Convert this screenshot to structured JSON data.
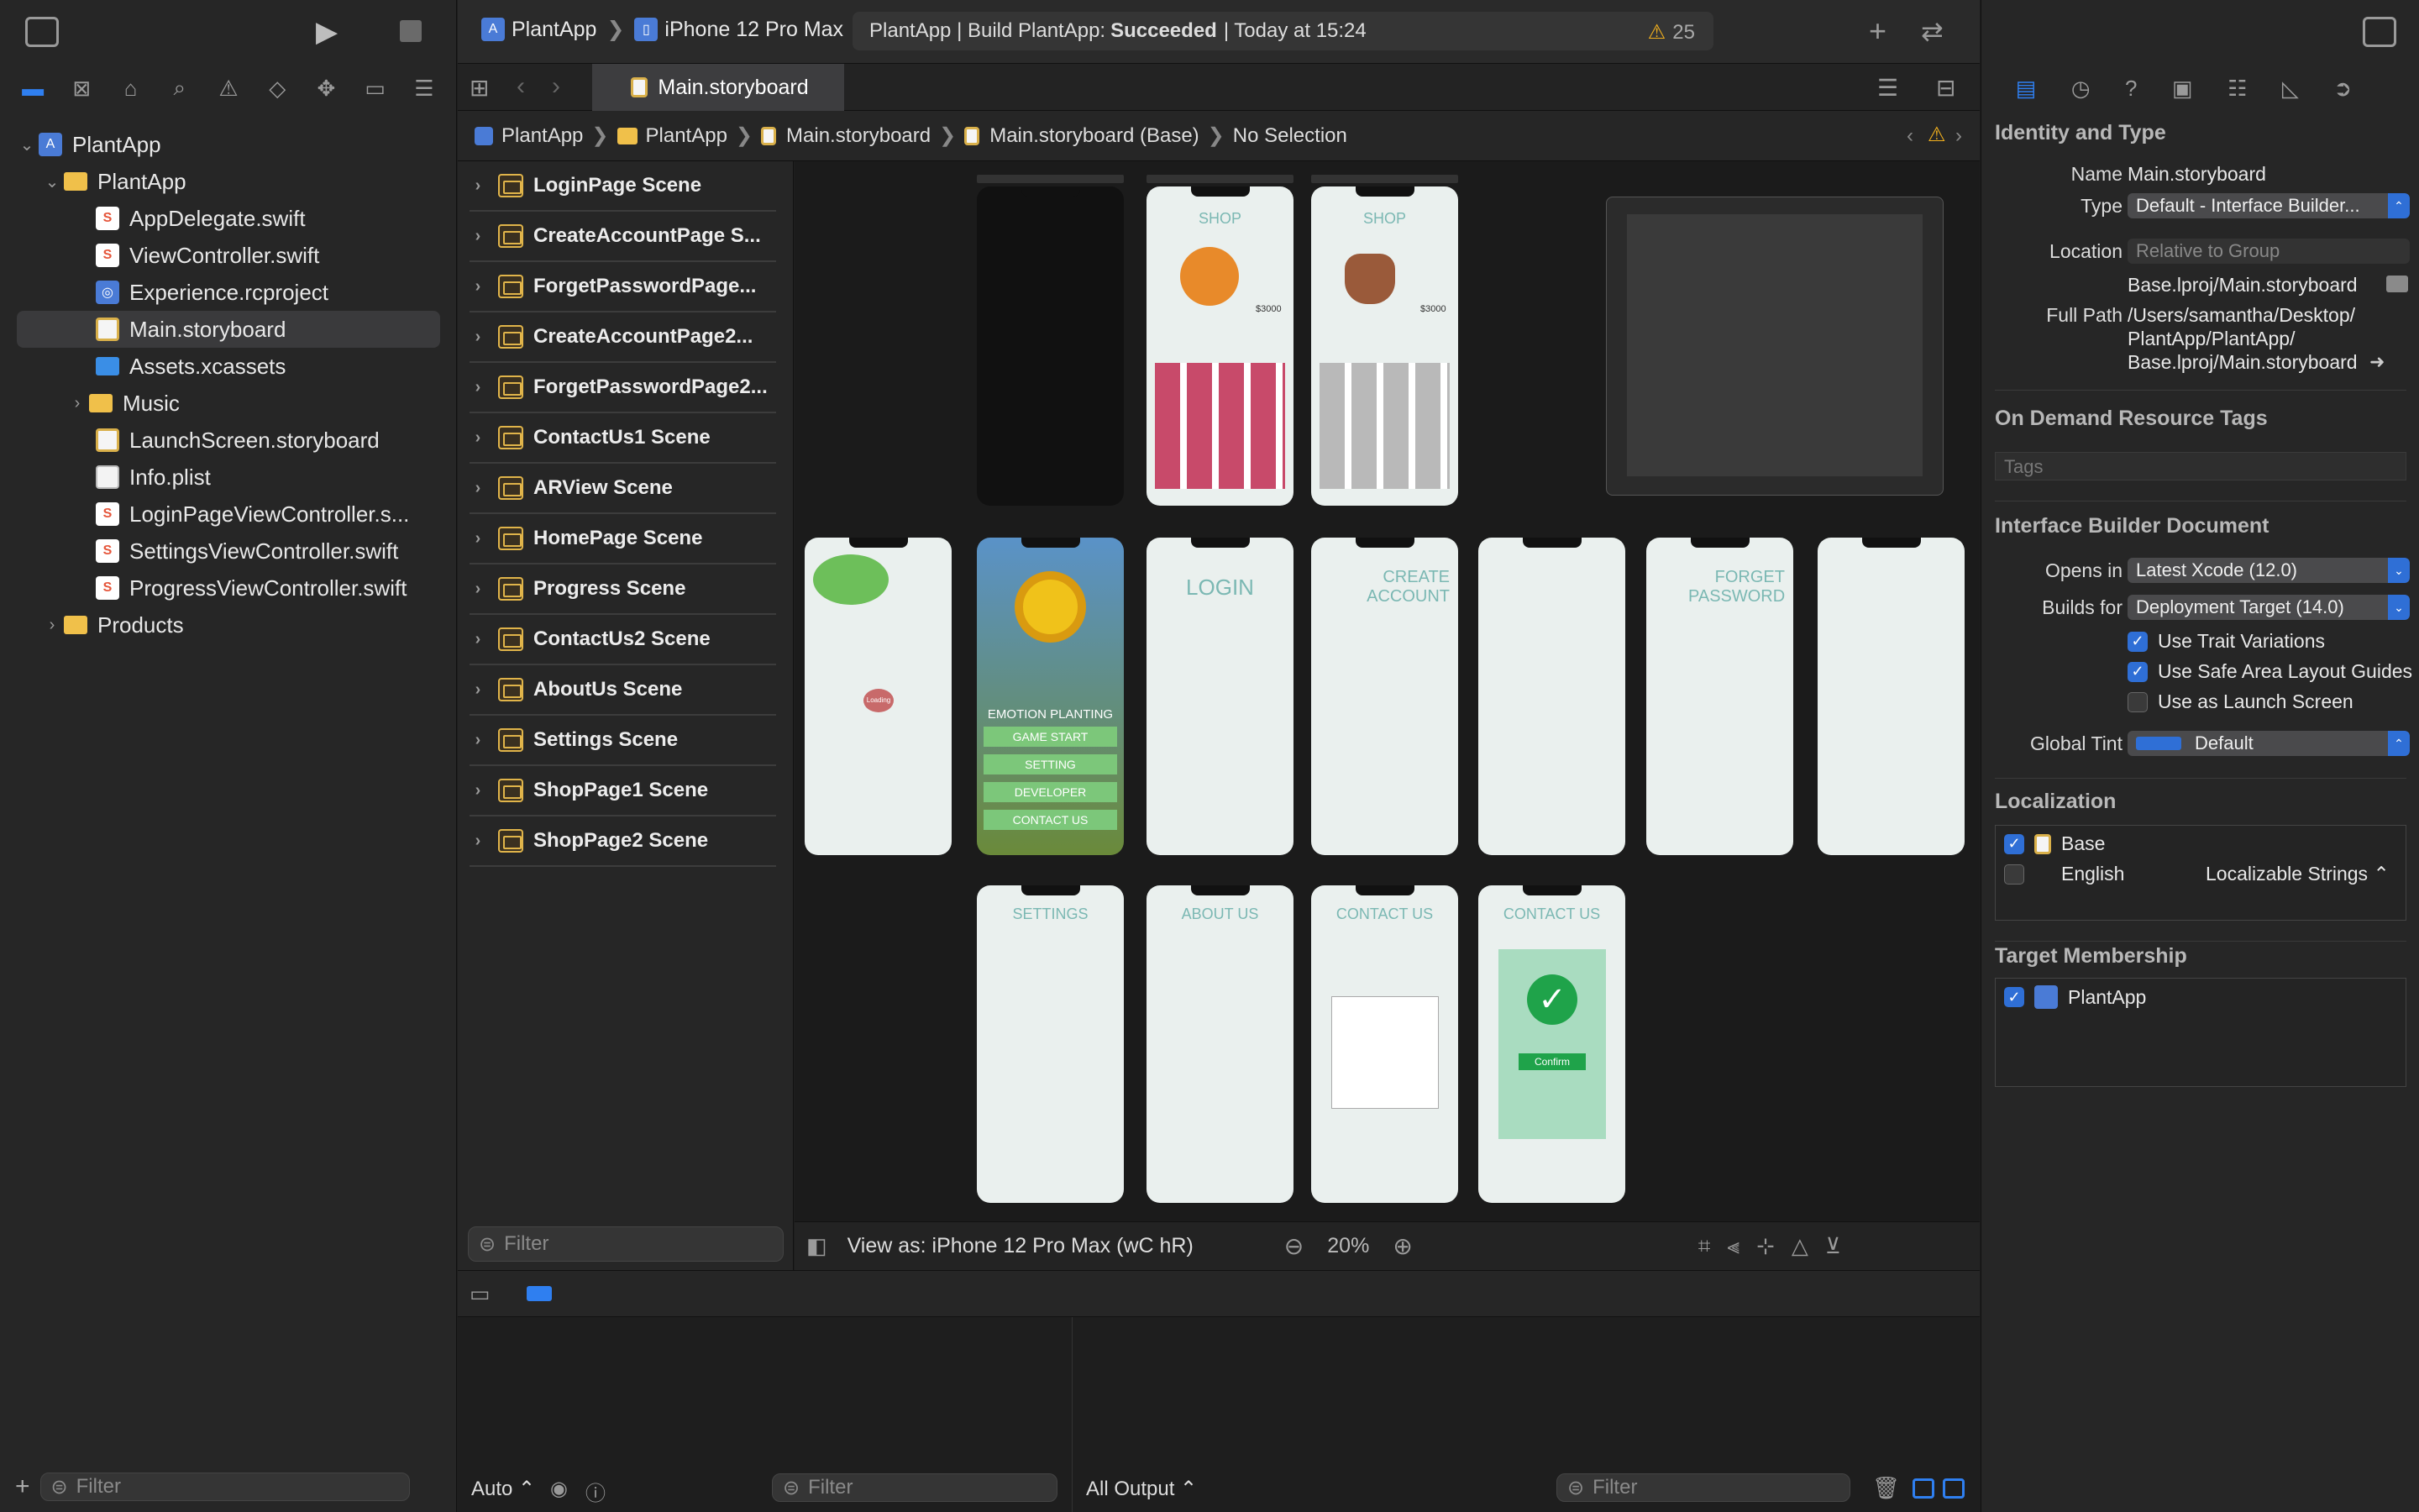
{
  "scheme": {
    "project": "PlantApp",
    "device": "iPhone 12 Pro Max"
  },
  "status": {
    "text_prefix": "PlantApp | Build PlantApp: ",
    "result": "Succeeded",
    "time": "| Today at 15:24",
    "warnings": "25"
  },
  "navigator": {
    "items": [
      {
        "label": "PlantApp",
        "kind": "project"
      },
      {
        "label": "PlantApp",
        "kind": "folder"
      },
      {
        "label": "AppDelegate.swift",
        "kind": "swift"
      },
      {
        "label": "ViewController.swift",
        "kind": "swift"
      },
      {
        "label": "Experience.rcproject",
        "kind": "rc"
      },
      {
        "label": "Main.storyboard",
        "kind": "storyboard"
      },
      {
        "label": "Assets.xcassets",
        "kind": "assets"
      },
      {
        "label": "Music",
        "kind": "folder"
      },
      {
        "label": "LaunchScreen.storyboard",
        "kind": "storyboard"
      },
      {
        "label": "Info.plist",
        "kind": "plist"
      },
      {
        "label": "LoginPageViewController.s...",
        "kind": "swift"
      },
      {
        "label": "SettingsViewController.swift",
        "kind": "swift"
      },
      {
        "label": "ProgressViewController.swift",
        "kind": "swift"
      },
      {
        "label": "Products",
        "kind": "folder"
      }
    ],
    "filter_placeholder": "Filter"
  },
  "editor": {
    "tab_label": "Main.storyboard",
    "jump": [
      "PlantApp",
      "PlantApp",
      "Main.storyboard",
      "Main.storyboard (Base)",
      "No Selection"
    ]
  },
  "outline": {
    "scenes": [
      "LoginPage Scene",
      "CreateAccountPage S...",
      "ForgetPasswordPage...",
      "CreateAccountPage2...",
      "ForgetPasswordPage2...",
      "ContactUs1 Scene",
      "ARView Scene",
      "HomePage Scene",
      "Progress Scene",
      "ContactUs2 Scene",
      "AboutUs Scene",
      "Settings Scene",
      "ShopPage1 Scene",
      "ShopPage2 Scene"
    ],
    "filter_placeholder": "Filter"
  },
  "canvas": {
    "view_as": "View as: iPhone 12 Pro Max (wC hR)",
    "zoom": "20%",
    "phones": {
      "shop1_title": "SHOP",
      "shop1_price": "$3000",
      "shop2_title": "SHOP",
      "shop2_price": "$3000",
      "home_title": "EMOTION PLANTING",
      "home_buttons": [
        "GAME START",
        "SETTING",
        "DEVELOPER",
        "CONTACT US"
      ],
      "login": "LOGIN",
      "create": "CREATE ACCOUNT",
      "forget": "FORGET PASSWORD",
      "settings": "SETTINGS",
      "about": "ABOUT US",
      "contact1": "CONTACT US",
      "contact2": "CONTACT US",
      "confirm": "Confirm",
      "loading": "Loading"
    }
  },
  "debug": {
    "auto": "Auto",
    "filter": "Filter",
    "output": "All Output",
    "filter2": "Filter"
  },
  "inspector": {
    "identity_title": "Identity and Type",
    "name_label": "Name",
    "name": "Main.storyboard",
    "type_label": "Type",
    "type": "Default - Interface Builder...",
    "location_label": "Location",
    "location": "Relative to Group",
    "location_path": "Base.lproj/Main.storyboard",
    "fullpath_label": "Full Path",
    "fullpath": [
      "/Users/samantha/Desktop/",
      "PlantApp/PlantApp/",
      "Base.lproj/Main.storyboard"
    ],
    "ondemand_title": "On Demand Resource Tags",
    "tags_placeholder": "Tags",
    "ibdoc_title": "Interface Builder Document",
    "opens_label": "Opens in",
    "opens": "Latest Xcode (12.0)",
    "builds_label": "Builds for",
    "builds": "Deployment Target (14.0)",
    "checks": [
      {
        "label": "Use Trait Variations",
        "checked": true
      },
      {
        "label": "Use Safe Area Layout Guides",
        "checked": true
      },
      {
        "label": "Use as Launch Screen",
        "checked": false
      }
    ],
    "tint_label": "Global Tint",
    "tint": "Default",
    "tint_color": "#2f6fd6",
    "localization_title": "Localization",
    "loc_base": "Base",
    "loc_english": "English",
    "loc_strings": "Localizable Strings",
    "target_title": "Target Membership",
    "target": "PlantApp"
  }
}
